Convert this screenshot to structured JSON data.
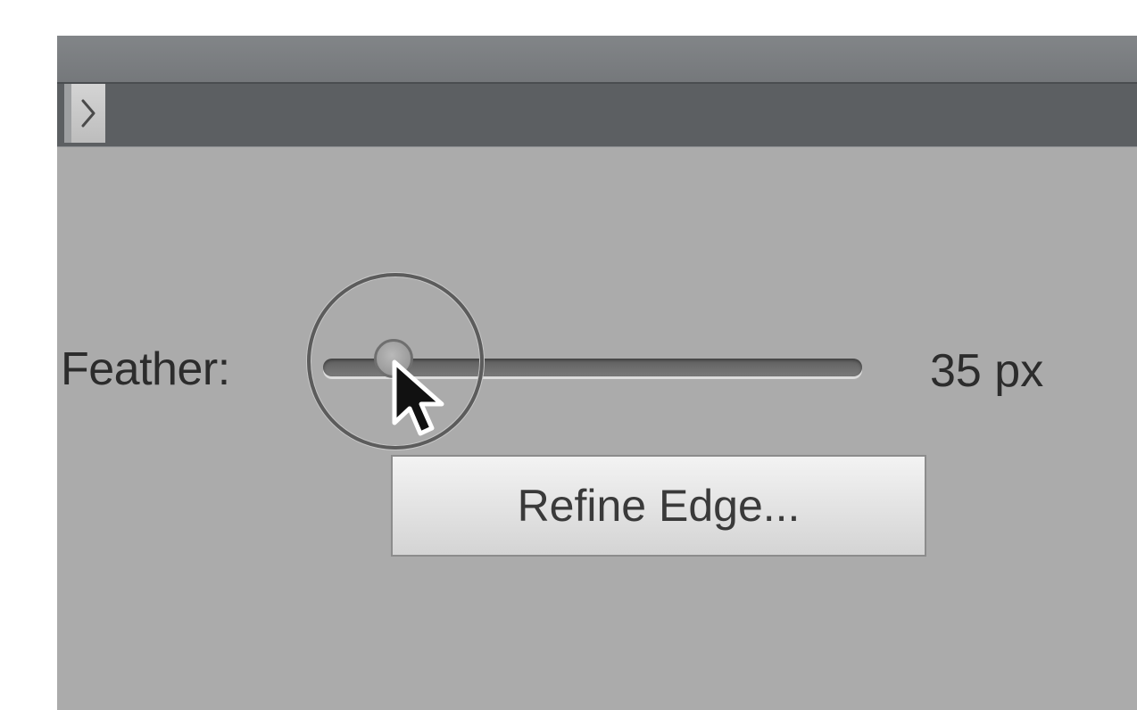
{
  "panel": {
    "expand_icon": "chevron-right-icon"
  },
  "feather": {
    "label": "Feather:",
    "value": 35,
    "value_text": "35 px",
    "slider_fraction": 0.13
  },
  "refine_button": {
    "label": "Refine Edge..."
  },
  "colors": {
    "panel_bg": "#ababab",
    "titlebar": "#7c7f82",
    "subbar": "#5c5f62",
    "button_bg": "#e6e6e6",
    "text": "#2c2c2c"
  }
}
